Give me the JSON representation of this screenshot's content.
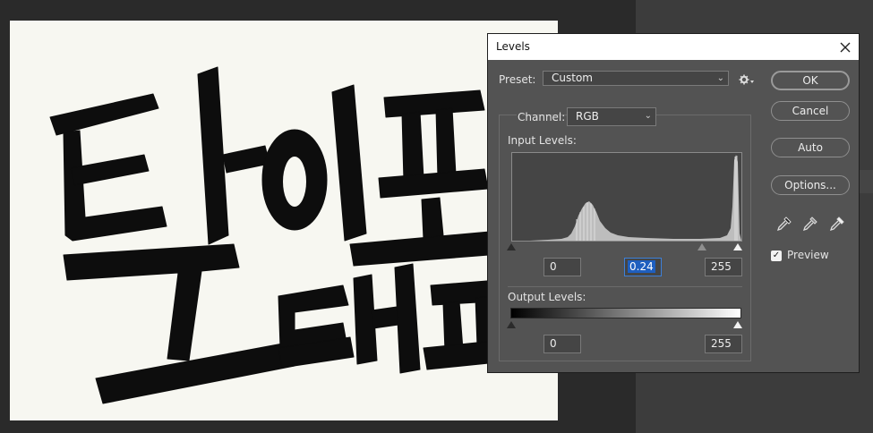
{
  "dialog": {
    "title": "Levels",
    "close_label": "✕",
    "preset": {
      "label": "Preset:",
      "label_accel": "s",
      "value": "Custom"
    },
    "channel": {
      "label": "Channel:",
      "value": "RGB"
    },
    "input_levels": {
      "label": "Input Levels:",
      "black": "0",
      "midtone": "0.24",
      "white": "255"
    },
    "output_levels": {
      "label": "Output Levels:",
      "black": "0",
      "white": "255"
    },
    "buttons": {
      "ok": "OK",
      "cancel": "Cancel",
      "auto": "Auto",
      "options": "Options..."
    },
    "preview": {
      "label": "Preview",
      "checked": true
    },
    "icons": [
      "gear-icon",
      "chevron-down-icon",
      "black-eyedropper-icon",
      "gray-eyedropper-icon",
      "white-eyedropper-icon",
      "close-icon"
    ]
  }
}
